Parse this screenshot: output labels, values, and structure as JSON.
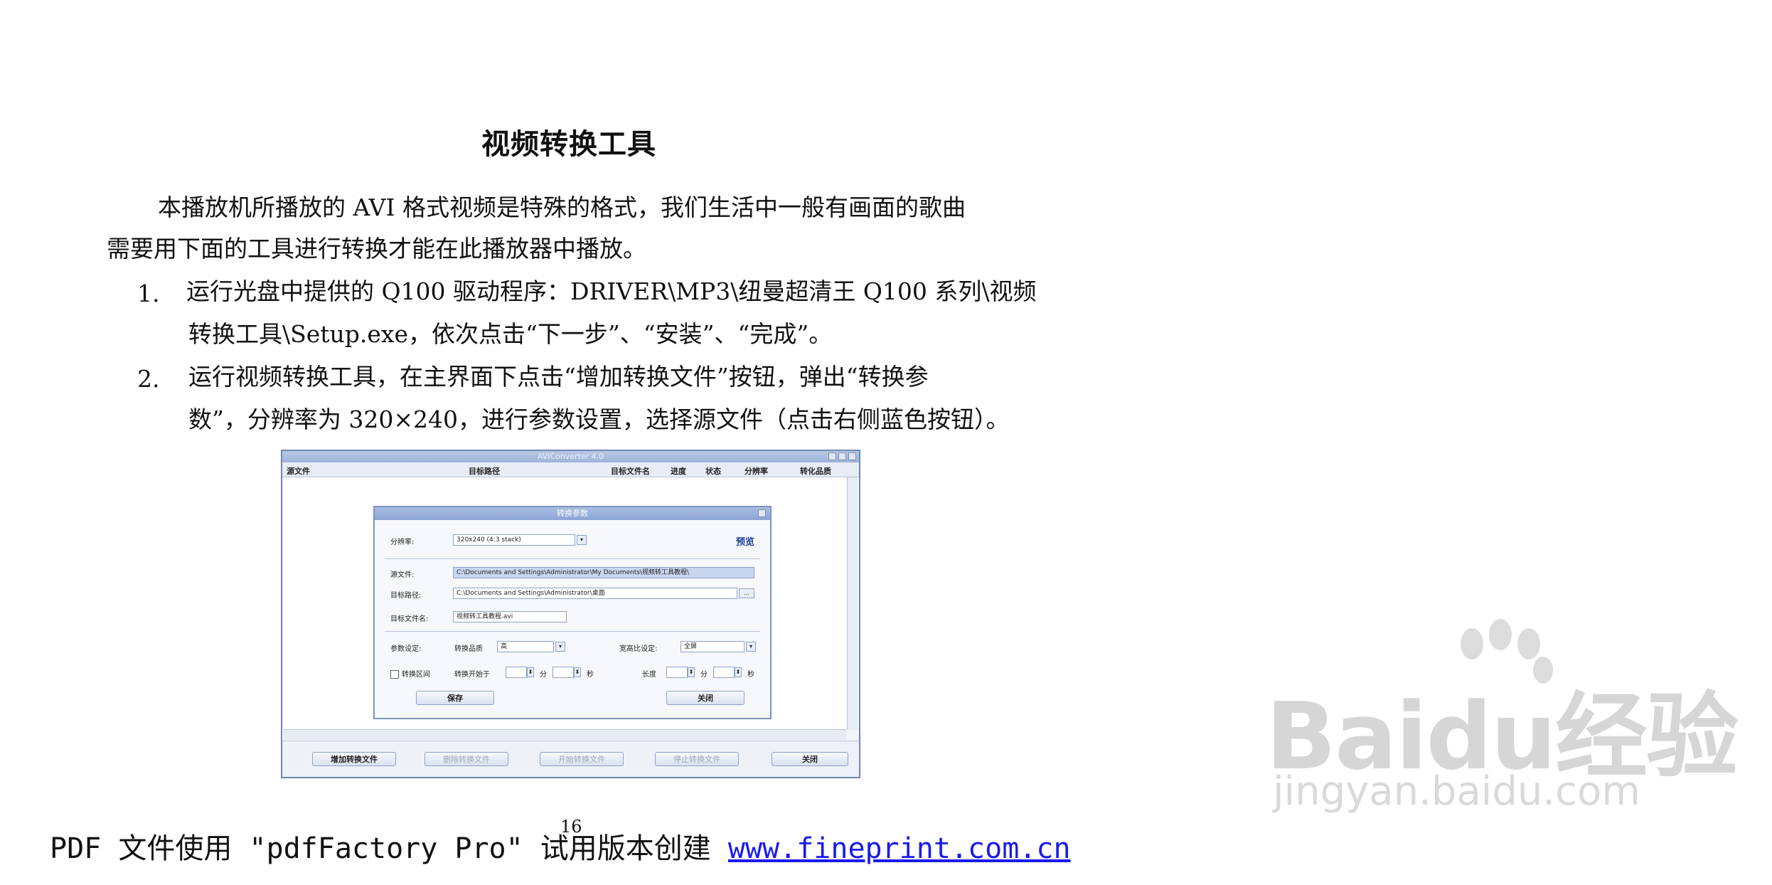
{
  "document": {
    "title": "视频转换工具",
    "intro_line1": "本播放机所播放的 AVI 格式视频是特殊的格式，我们生活中一般有画面的歌曲",
    "intro_line2": "需要用下面的工具进行转换才能在此播放器中播放。",
    "steps": [
      {
        "number": "1.",
        "line1": "运行光盘中提供的 Q100 驱动程序：DRIVER\\MP3\\纽曼超清王 Q100 系列\\视频",
        "line2": "转换工具\\Setup.exe，依次点击“下一步”、“安装”、“完成”。"
      },
      {
        "number": "2.",
        "line1": "运行视频转换工具，在主界面下点击“增加转换文件”按钮，弹出“转换参",
        "line2": "数”，分辨率为 320×240，进行参数设置，选择源文件（点击右侧蓝色按钮）。"
      }
    ]
  },
  "screenshot": {
    "window_title": "AVIConverter 4.0",
    "columns": [
      "源文件",
      "目标路径",
      "目标文件名",
      "进度",
      "状态",
      "分辨率",
      "转化品质"
    ],
    "dialog": {
      "title": "转换参数",
      "resolution_label": "分辨率:",
      "resolution_value": "320x240 (4:3 stack)",
      "preview_label": "预览",
      "source_label": "源文件:",
      "source_value": "C:\\Documents and Settings\\Administrator\\My Documents\\视频转工具教程\\",
      "target_path_label": "目标路径:",
      "target_path_value": "C:\\Documents and Settings\\Administrator\\桌面",
      "target_name_label": "目标文件名:",
      "target_name_value": "视频转工具教程.avi",
      "params_label": "参数设定:",
      "quality_label": "转换品质",
      "quality_value": "高",
      "ratio_label": "宽高比设定:",
      "ratio_value": "全屏",
      "cut_label": "转换区间",
      "cut_start_label": "转换开始于",
      "cut_length_label": "长度",
      "unit_min": "分",
      "unit_sec": "秒",
      "save_button": "保存",
      "close_button": "关闭"
    },
    "bottom_buttons": [
      "增加转换文件",
      "删除转换文件",
      "开始转换文件",
      "停止转换文件",
      "关闭"
    ]
  },
  "watermark": {
    "brand": "Baidu经验",
    "site": "jingyan.baidu.com"
  },
  "footer": {
    "text": "PDF 文件使用 \"pdfFactory Pro\" 试用版本创建 ",
    "link": "www.fineprint.com.cn",
    "page_number": "16"
  }
}
